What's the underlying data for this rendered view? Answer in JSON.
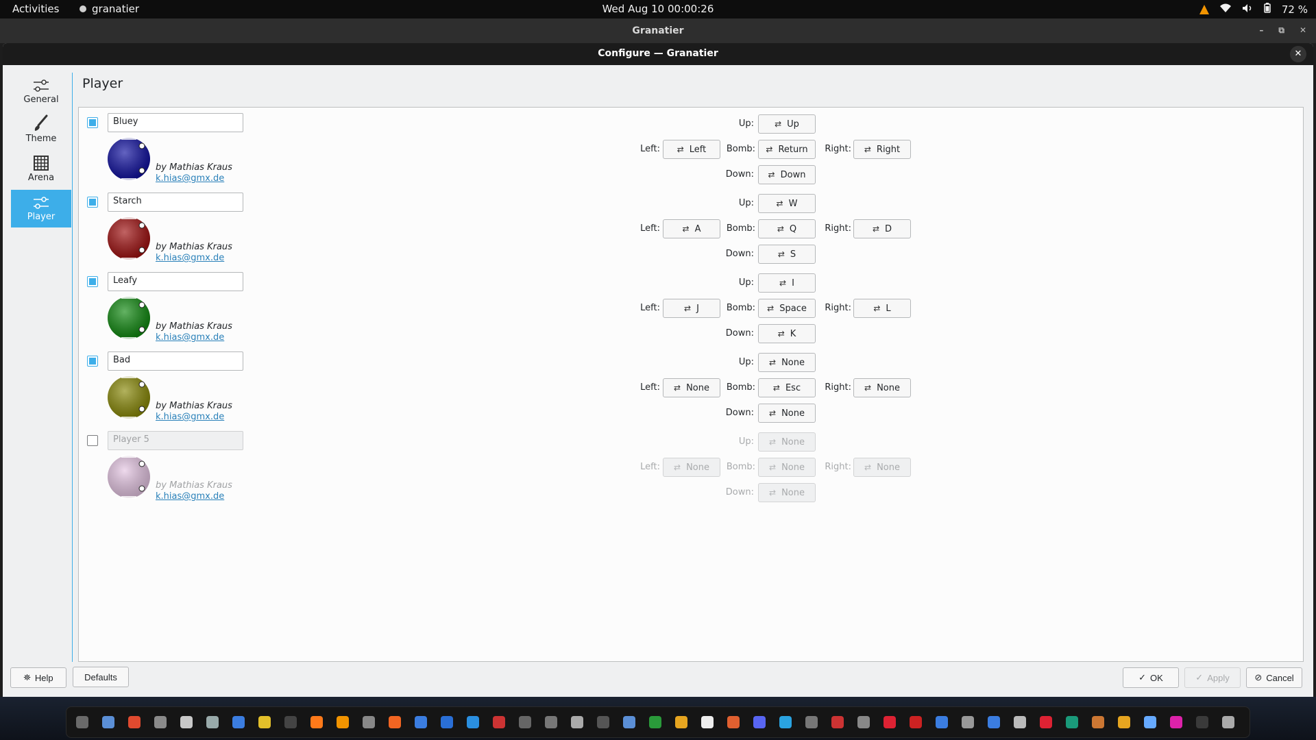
{
  "topbar": {
    "activities": "Activities",
    "app_name": "granatier",
    "clock": "Wed Aug 10  00:00:26",
    "battery": "72 %"
  },
  "window": {
    "title": "Granatier"
  },
  "dialog": {
    "title": "Configure — Granatier",
    "close_glyph": "✕"
  },
  "sidebar": {
    "items": [
      {
        "label": "General",
        "icon": "sliders-icon"
      },
      {
        "label": "Theme",
        "icon": "brush-icon"
      },
      {
        "label": "Arena",
        "icon": "grid-icon"
      },
      {
        "label": "Player",
        "icon": "player-slider-icon",
        "active": true
      }
    ]
  },
  "page": {
    "title": "Player"
  },
  "labels": {
    "up": "Up:",
    "left": "Left:",
    "bomb": "Bomb:",
    "right": "Right:",
    "down": "Down:"
  },
  "players": [
    {
      "enabled": true,
      "name": "Bluey",
      "color": "#1010a0",
      "author": "by Mathias Kraus",
      "email": "k.hias@gmx.de",
      "keys": {
        "up": "Up",
        "left": "Left",
        "bomb": "Return",
        "right": "Right",
        "down": "Down"
      }
    },
    {
      "enabled": true,
      "name": "Starch",
      "color": "#a01010",
      "author": "by Mathias Kraus",
      "email": "k.hias@gmx.de",
      "keys": {
        "up": "W",
        "left": "A",
        "bomb": "Q",
        "right": "D",
        "down": "S"
      }
    },
    {
      "enabled": true,
      "name": "Leafy",
      "color": "#108a10",
      "author": "by Mathias Kraus",
      "email": "k.hias@gmx.de",
      "keys": {
        "up": "I",
        "left": "J",
        "bomb": "Space",
        "right": "L",
        "down": "K"
      }
    },
    {
      "enabled": true,
      "name": "Bad",
      "color": "#8a8a08",
      "author": "by Mathias Kraus",
      "email": "k.hias@gmx.de",
      "keys": {
        "up": "None",
        "left": "None",
        "bomb": "Esc",
        "right": "None",
        "down": "None"
      }
    },
    {
      "enabled": false,
      "name": "Player 5",
      "color": "#e6c6e4",
      "author": "by Mathias Kraus",
      "email": "k.hias@gmx.de",
      "keys": {
        "up": "None",
        "left": "None",
        "bomb": "None",
        "right": "None",
        "down": "None"
      }
    }
  ],
  "footer": {
    "help": "Help",
    "defaults": "Defaults",
    "ok": "OK",
    "apply": "Apply",
    "cancel": "Cancel"
  },
  "colors": {
    "accent": "#3daee9",
    "link": "#2980b9"
  }
}
